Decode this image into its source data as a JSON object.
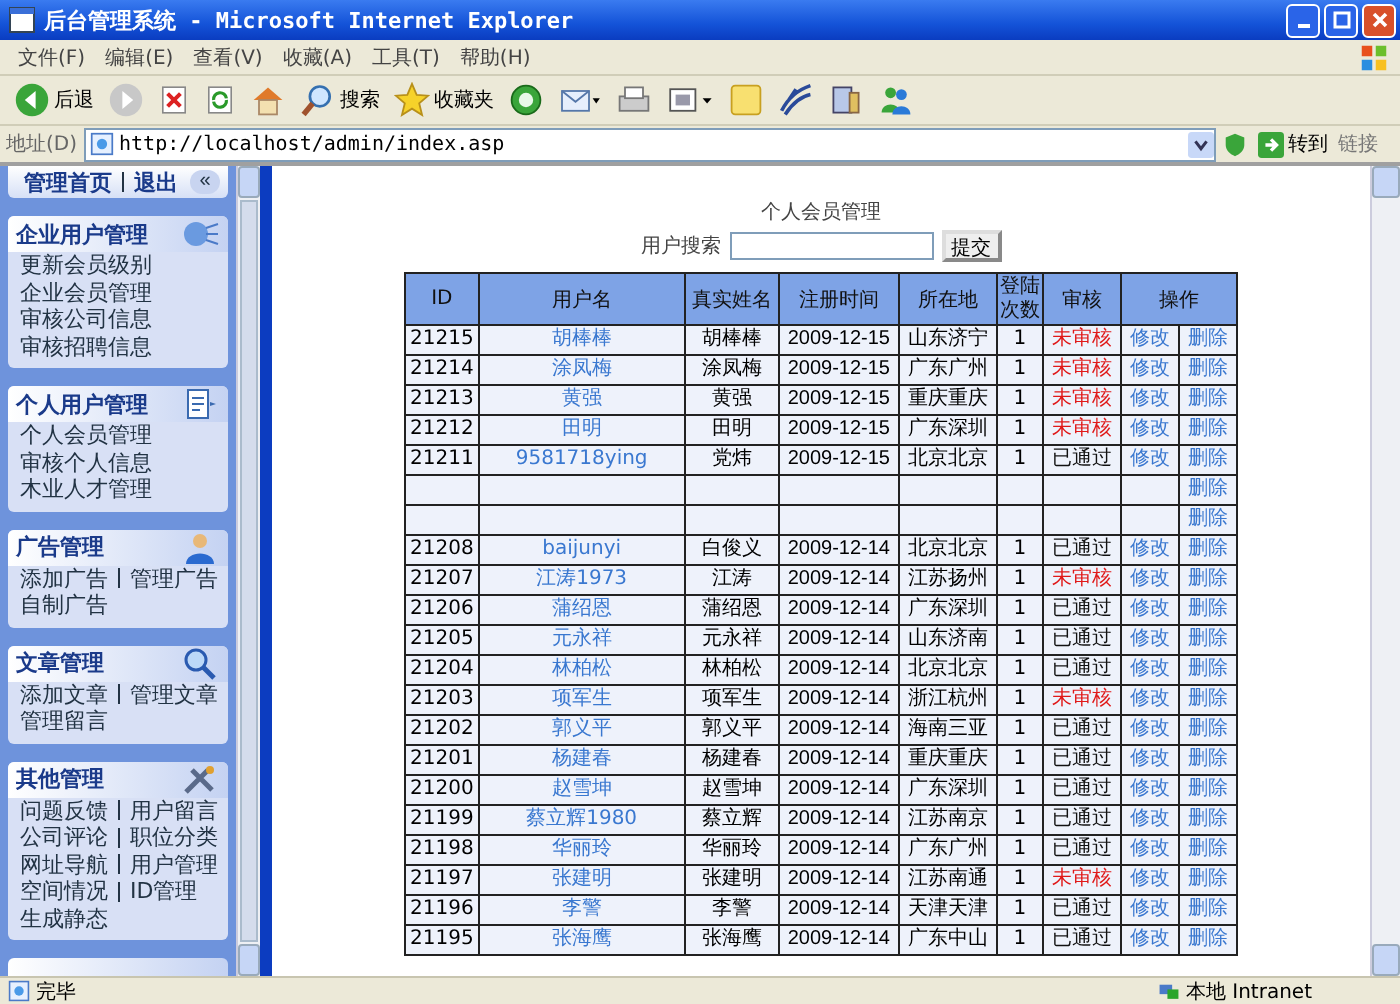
{
  "window": {
    "title": "后台管理系统 - Microsoft Internet Explorer"
  },
  "menu": [
    "文件(F)",
    "编辑(E)",
    "查看(V)",
    "收藏(A)",
    "工具(T)",
    "帮助(H)"
  ],
  "toolbar": [
    {
      "kind": "back",
      "label": "后退"
    },
    {
      "kind": "forward"
    },
    {
      "kind": "stop"
    },
    {
      "kind": "refresh"
    },
    {
      "kind": "home"
    },
    {
      "kind": "search",
      "label": "搜索"
    },
    {
      "kind": "favorites",
      "label": "收藏夹"
    },
    {
      "kind": "media"
    },
    {
      "kind": "mail"
    },
    {
      "kind": "print"
    },
    {
      "kind": "edit"
    },
    {
      "kind": "note"
    },
    {
      "kind": "research"
    },
    {
      "kind": "tools"
    },
    {
      "kind": "messenger"
    }
  ],
  "address": {
    "label": "地址(D)",
    "url": "http://localhost/admin/index.asp",
    "go": "转到",
    "links": "链接"
  },
  "sidebar": {
    "top_links": [
      "管理首页",
      "退出"
    ],
    "collapse": "«",
    "sections": [
      {
        "title": "企业用户管理",
        "lines": [
          [
            "更新会员级别"
          ],
          [
            "企业会员管理"
          ],
          [
            "审核公司信息"
          ],
          [
            "审核招聘信息"
          ]
        ]
      },
      {
        "title": "个人用户管理",
        "lines": [
          [
            "个人会员管理"
          ],
          [
            "审核个人信息"
          ],
          [
            "木业人才管理"
          ]
        ]
      },
      {
        "title": "广告管理",
        "lines": [
          [
            "添加广告",
            "管理广告"
          ],
          [
            "自制广告"
          ]
        ]
      },
      {
        "title": "文章管理",
        "lines": [
          [
            "添加文章",
            "管理文章"
          ],
          [
            "管理留言"
          ]
        ]
      },
      {
        "title": "其他管理",
        "lines": [
          [
            "问题反馈",
            "用户留言"
          ],
          [
            "公司评论",
            "职位分类"
          ],
          [
            "网址导航",
            "用户管理"
          ],
          [
            "空间情况",
            "ID管理"
          ],
          [
            "生成静态"
          ]
        ]
      }
    ]
  },
  "main": {
    "heading": "个人会员管理",
    "search": {
      "label": "用户搜索",
      "button": "提交"
    },
    "table": {
      "columns": [
        "ID",
        "用户名",
        "真实姓名",
        "注册时间",
        "所在地",
        "登陆次数",
        "审核",
        "操作"
      ],
      "rows": [
        {
          "id": "21215",
          "username": "胡棒棒",
          "real_name": "胡棒棒",
          "date": "2009-12-15",
          "location": "山东济宁",
          "logins": "1",
          "status": "未审核",
          "approved": false,
          "edit": "修改",
          "delete": "删除"
        },
        {
          "id": "21214",
          "username": "涂凤梅",
          "real_name": "涂凤梅",
          "date": "2009-12-15",
          "location": "广东广州",
          "logins": "1",
          "status": "未审核",
          "approved": false,
          "edit": "修改",
          "delete": "删除"
        },
        {
          "id": "21213",
          "username": "黄强",
          "real_name": "黄强",
          "date": "2009-12-15",
          "location": "重庆重庆",
          "logins": "1",
          "status": "未审核",
          "approved": false,
          "edit": "修改",
          "delete": "删除"
        },
        {
          "id": "21212",
          "username": "田明",
          "real_name": "田明",
          "date": "2009-12-15",
          "location": "广东深圳",
          "logins": "1",
          "status": "未审核",
          "approved": false,
          "edit": "修改",
          "delete": "删除"
        },
        {
          "id": "21211",
          "username": "9581718ying",
          "real_name": "党炜",
          "date": "2009-12-15",
          "location": "北京北京",
          "logins": "1",
          "status": "已通过",
          "approved": true,
          "edit": "修改",
          "delete": "删除"
        },
        {
          "delete": "删除"
        },
        {
          "delete": "删除"
        },
        {
          "id": "21208",
          "username": "baijunyi",
          "real_name": "白俊义",
          "date": "2009-12-14",
          "location": "北京北京",
          "logins": "1",
          "status": "已通过",
          "approved": true,
          "edit": "修改",
          "delete": "删除"
        },
        {
          "id": "21207",
          "username": "江涛1973",
          "real_name": "江涛",
          "date": "2009-12-14",
          "location": "江苏扬州",
          "logins": "1",
          "status": "未审核",
          "approved": false,
          "edit": "修改",
          "delete": "删除"
        },
        {
          "id": "21206",
          "username": "蒲绍恩",
          "real_name": "蒲绍恩",
          "date": "2009-12-14",
          "location": "广东深圳",
          "logins": "1",
          "status": "已通过",
          "approved": true,
          "edit": "修改",
          "delete": "删除"
        },
        {
          "id": "21205",
          "username": "元永祥",
          "real_name": "元永祥",
          "date": "2009-12-14",
          "location": "山东济南",
          "logins": "1",
          "status": "已通过",
          "approved": true,
          "edit": "修改",
          "delete": "删除"
        },
        {
          "id": "21204",
          "username": "林柏松",
          "real_name": "林柏松",
          "date": "2009-12-14",
          "location": "北京北京",
          "logins": "1",
          "status": "已通过",
          "approved": true,
          "edit": "修改",
          "delete": "删除"
        },
        {
          "id": "21203",
          "username": "项军生",
          "real_name": "项军生",
          "date": "2009-12-14",
          "location": "浙江杭州",
          "logins": "1",
          "status": "未审核",
          "approved": false,
          "edit": "修改",
          "delete": "删除"
        },
        {
          "id": "21202",
          "username": "郭义平",
          "real_name": "郭义平",
          "date": "2009-12-14",
          "location": "海南三亚",
          "logins": "1",
          "status": "已通过",
          "approved": true,
          "edit": "修改",
          "delete": "删除"
        },
        {
          "id": "21201",
          "username": "杨建春",
          "real_name": "杨建春",
          "date": "2009-12-14",
          "location": "重庆重庆",
          "logins": "1",
          "status": "已通过",
          "approved": true,
          "edit": "修改",
          "delete": "删除"
        },
        {
          "id": "21200",
          "username": "赵雪坤",
          "real_name": "赵雪坤",
          "date": "2009-12-14",
          "location": "广东深圳",
          "logins": "1",
          "status": "已通过",
          "approved": true,
          "edit": "修改",
          "delete": "删除"
        },
        {
          "id": "21199",
          "username": "蔡立辉1980",
          "real_name": "蔡立辉",
          "date": "2009-12-14",
          "location": "江苏南京",
          "logins": "1",
          "status": "已通过",
          "approved": true,
          "edit": "修改",
          "delete": "删除"
        },
        {
          "id": "21198",
          "username": "华丽玲",
          "real_name": "华丽玲",
          "date": "2009-12-14",
          "location": "广东广州",
          "logins": "1",
          "status": "已通过",
          "approved": true,
          "edit": "修改",
          "delete": "删除"
        },
        {
          "id": "21197",
          "username": "张建明",
          "real_name": "张建明",
          "date": "2009-12-14",
          "location": "江苏南通",
          "logins": "1",
          "status": "未审核",
          "approved": false,
          "edit": "修改",
          "delete": "删除"
        },
        {
          "id": "21196",
          "username": "李警",
          "real_name": "李警",
          "date": "2009-12-14",
          "location": "天津天津",
          "logins": "1",
          "status": "已通过",
          "approved": true,
          "edit": "修改",
          "delete": "删除"
        },
        {
          "id": "21195",
          "username": "张海鹰",
          "real_name": "张海鹰",
          "date": "2009-12-14",
          "location": "广东中山",
          "logins": "1",
          "status": "已通过",
          "approved": true,
          "edit": "修改",
          "delete": "删除"
        }
      ]
    }
  },
  "status_bar": {
    "text": "完毕",
    "zone": "本地 Intranet"
  }
}
